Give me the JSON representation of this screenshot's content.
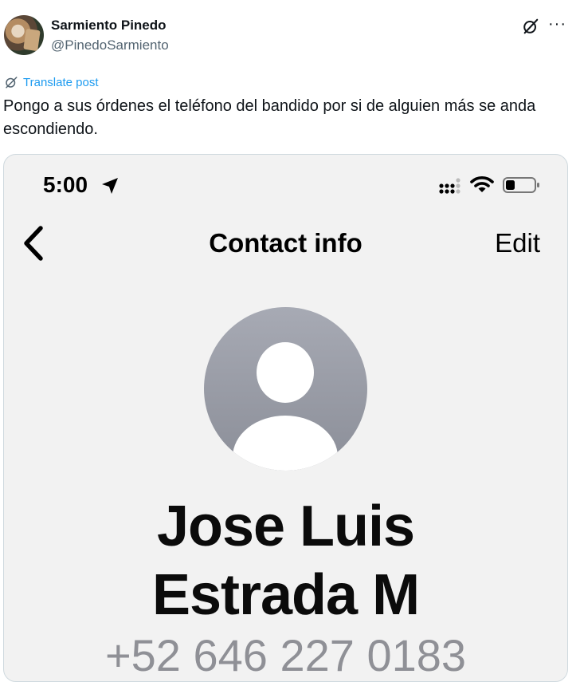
{
  "post": {
    "display_name": "Sarmiento Pinedo",
    "handle": "@PinedoSarmiento",
    "translate_label": "Translate post",
    "text": "Pongo a sus órdenes el teléfono del bandido por si de alguien más se anda escondiendo.",
    "more_icon": "more-icon",
    "grok_icon": "grok-icon"
  },
  "phone": {
    "status_time": "5:00",
    "nav_title": "Contact info",
    "edit_label": "Edit",
    "contact_name_line1": "Jose Luis",
    "contact_name_line2": "Estrada M",
    "contact_phone": "+52 646 227 0183"
  },
  "colors": {
    "link_blue": "#1d9bf0",
    "secondary_text": "#536471",
    "media_border": "#cfd9de"
  }
}
